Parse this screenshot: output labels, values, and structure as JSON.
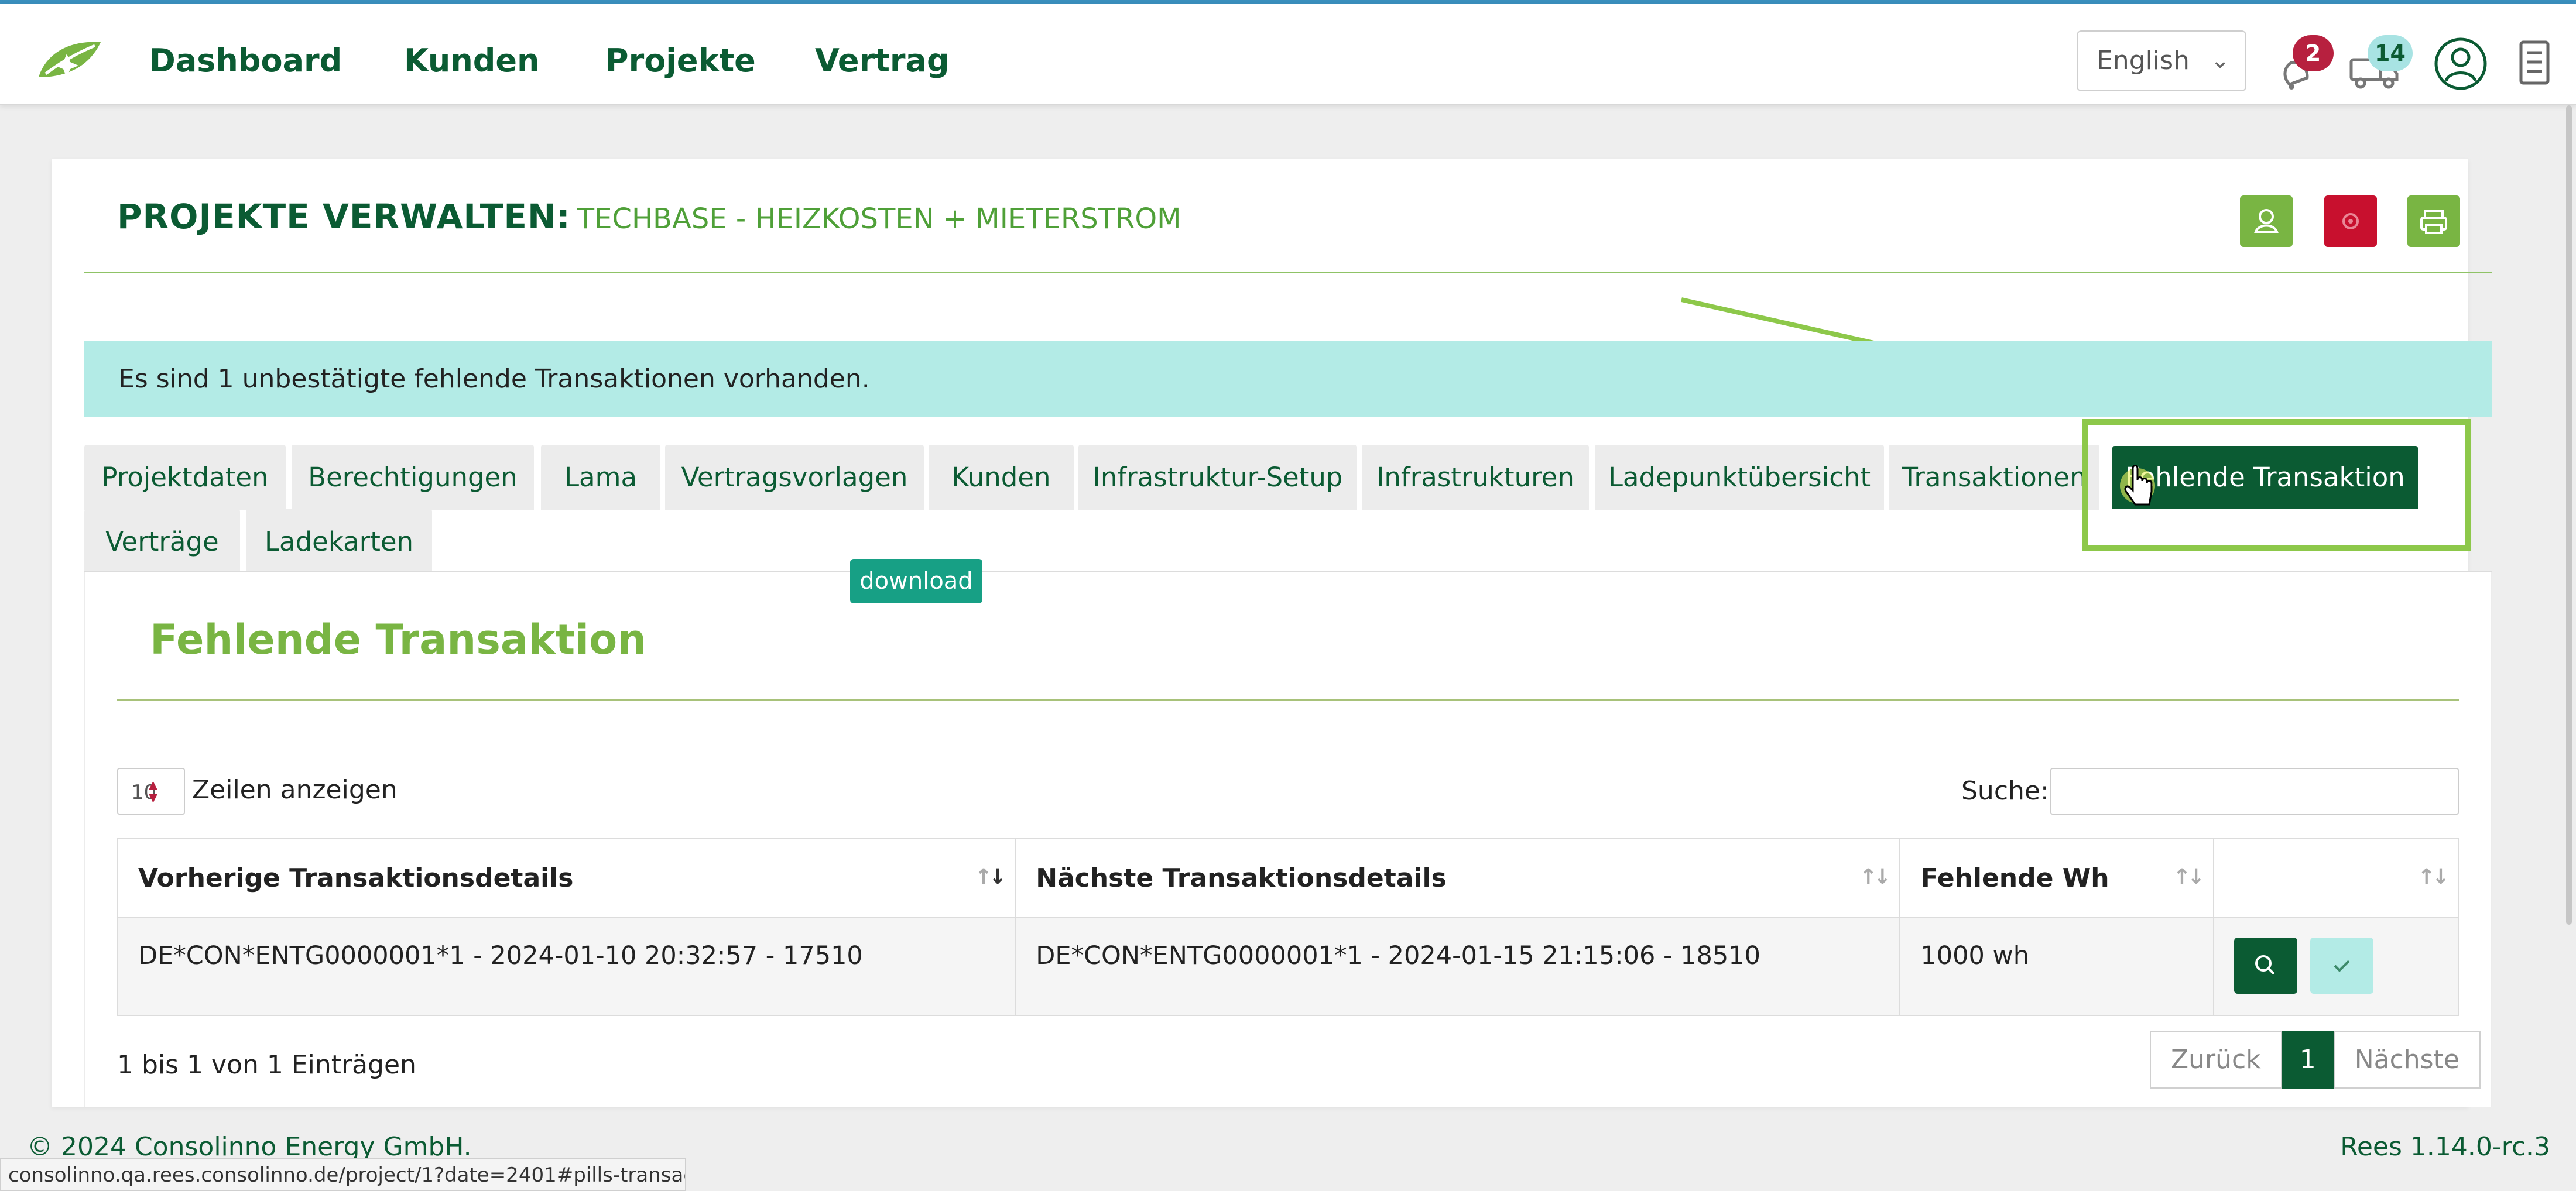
{
  "nav": {
    "links": [
      "Dashboard",
      "Kunden",
      "Projekte",
      "Vertrag"
    ],
    "language": "English",
    "notifications_count": "2",
    "messages_count": "14"
  },
  "header": {
    "title_strong": "PROJEKTE VERWALTEN:",
    "title_project": "TECHBASE - HEIZKOSTEN + MIETERSTROM"
  },
  "alert": "Es sind 1 unbestätigte fehlende Transaktionen vorhanden.",
  "tabs": [
    "Projektdaten",
    "Berechtigungen",
    "Lama",
    "Vertragsvorlagen",
    "Kunden",
    "Infrastruktur-Setup",
    "Infrastrukturen",
    "Ladepunktübersicht",
    "Transaktionen",
    "Fehlende Transaktion",
    "Verträge",
    "Ladekarten"
  ],
  "active_tab": "Fehlende Transaktion",
  "download_label": "download",
  "section_title": "Fehlende Transaktion",
  "table_controls": {
    "page_length": "10",
    "length_label": "Zeilen anzeigen",
    "search_label": "Suche:",
    "search_value": ""
  },
  "table": {
    "columns": [
      "Vorherige Transaktionsdetails",
      "Nächste Transaktionsdetails",
      "Fehlende Wh",
      ""
    ],
    "rows": [
      [
        "DE*CON*ENTG0000001*1 - 2024-01-10 20:32:57 - 17510",
        "DE*CON*ENTG0000001*1 - 2024-01-15 21:15:06 - 18510",
        "1000 wh"
      ]
    ]
  },
  "table_info": "1 bis 1 von 1 Einträgen",
  "pagination": {
    "prev": "Zurück",
    "current": "1",
    "next": "Nächste"
  },
  "footer": {
    "copyright": "© 2024 Consolinno Energy GmbH.",
    "version": "Rees 1.14.0-rc.3"
  },
  "status_url": "consolinno.qa.rees.consolinno.de/project/1?date=2401#pills-transactiongap",
  "colors": {
    "brand_dark": "#0b5b33",
    "brand_light": "#79b543",
    "danger": "#c8102e",
    "alert_bg": "#b3ebe6"
  }
}
